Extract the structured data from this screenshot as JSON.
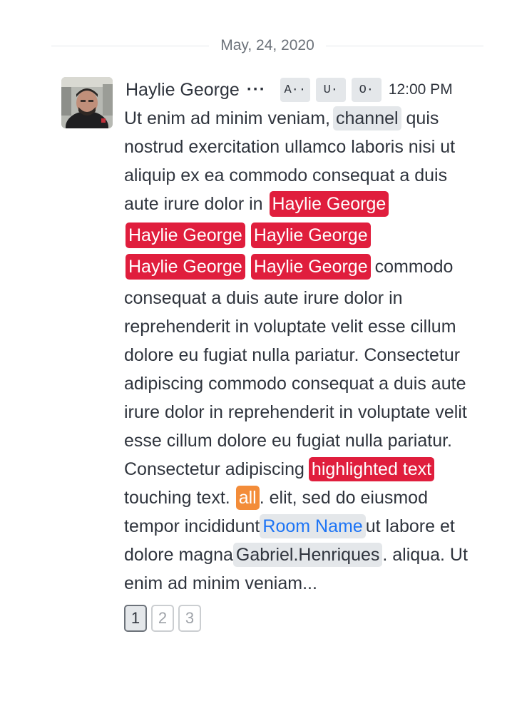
{
  "date_divider": "May, 24, 2020",
  "message": {
    "username": "Haylie George",
    "more_label": "···",
    "roles": [
      "A··",
      "U·",
      "O·"
    ],
    "time": "12:00 PM",
    "body": {
      "p1": "Ut enim ad minim veniam,",
      "channel_mention": "channel",
      "p2": "quis nostrud exercitation ullamco laboris nisi ut aliquip ex ea commodo consequat a duis aute irure dolor in",
      "user_mentions": [
        "Haylie George",
        "Haylie George",
        "Haylie George",
        "Haylie George",
        "Haylie George"
      ],
      "p3": "commodo consequat a duis aute irure dolor in reprehenderit in voluptate velit esse cillum dolore eu fugiat nulla pariatur. Consectetur adipiscing commodo consequat a duis aute irure dolor in reprehenderit in voluptate velit esse cillum dolore eu fugiat nulla pariatur. Consectetur adipiscing",
      "highlight": "highlighted text",
      "p4": "touching text.",
      "all_mention": "all",
      "p5": ". elit, sed do eiusmod tempor incididunt",
      "room_link": "Room Name",
      "p6": "ut labore et dolore magna",
      "user_chip": "Gabriel.Henriques",
      "p7": ". aliqua. Ut enim ad minim veniam..."
    },
    "pages": [
      "1",
      "2",
      "3"
    ],
    "active_page": "1"
  },
  "colors": {
    "mention_user": "#e01e3d",
    "mention_all": "#f38c39",
    "link": "#1d74f5",
    "chip_bg": "#e4e7ea"
  },
  "icons": {
    "avatar": "user-photo-avatar",
    "more": "kebab-menu-icon"
  }
}
